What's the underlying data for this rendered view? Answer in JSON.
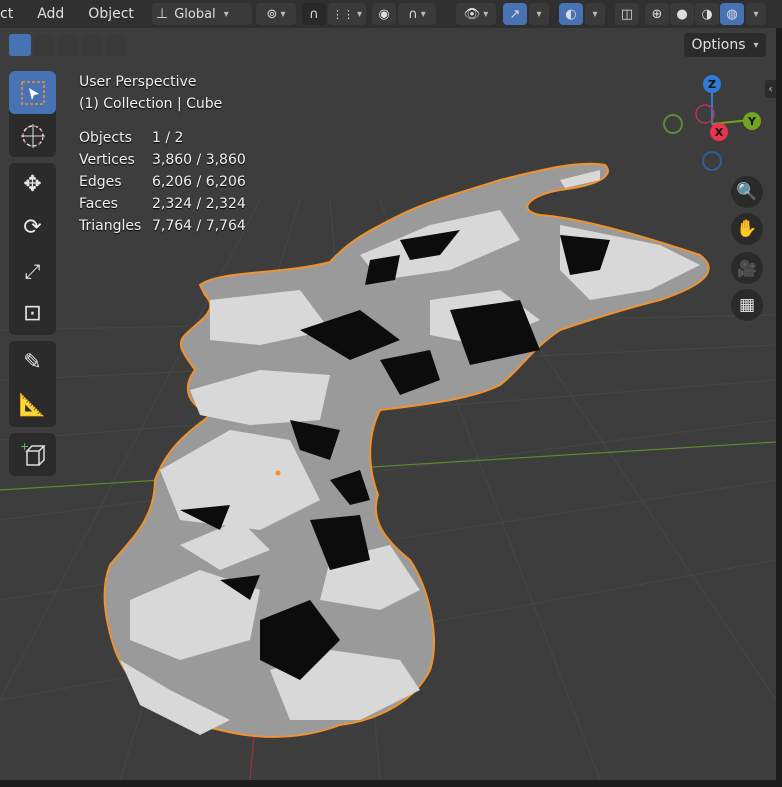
{
  "menu": {
    "items": [
      "ct",
      "Add",
      "Object"
    ]
  },
  "header": {
    "transform_orientation": "Global",
    "options_label": "Options"
  },
  "overlay": {
    "view_name": "User Perspective",
    "collection_line": "(1) Collection | Cube",
    "stats": [
      {
        "label": "Objects",
        "value": "1 / 2"
      },
      {
        "label": "Vertices",
        "value": "3,860 / 3,860"
      },
      {
        "label": "Edges",
        "value": "6,206 / 6,206"
      },
      {
        "label": "Faces",
        "value": "2,324 / 2,324"
      },
      {
        "label": "Triangles",
        "value": "7,764 / 7,764"
      }
    ]
  },
  "gizmo": {
    "z_label": "Z",
    "y_label": "Y",
    "x_label": "X",
    "colors": {
      "x": "#e8354f",
      "y": "#70a31f",
      "z": "#2f7ad6"
    }
  },
  "toolbar": {
    "tools": [
      "select-box",
      "cursor",
      "move",
      "rotate",
      "scale",
      "transform",
      "annotate",
      "measure",
      "add-cube"
    ],
    "active": "select-box"
  },
  "nav_buttons": [
    "zoom",
    "pan",
    "camera",
    "ortho-grid"
  ],
  "colors": {
    "accent": "#4772b3",
    "selection_outline": "#f0922e",
    "viewport_bg": "#3d3d3d",
    "header_bg": "#303030"
  }
}
